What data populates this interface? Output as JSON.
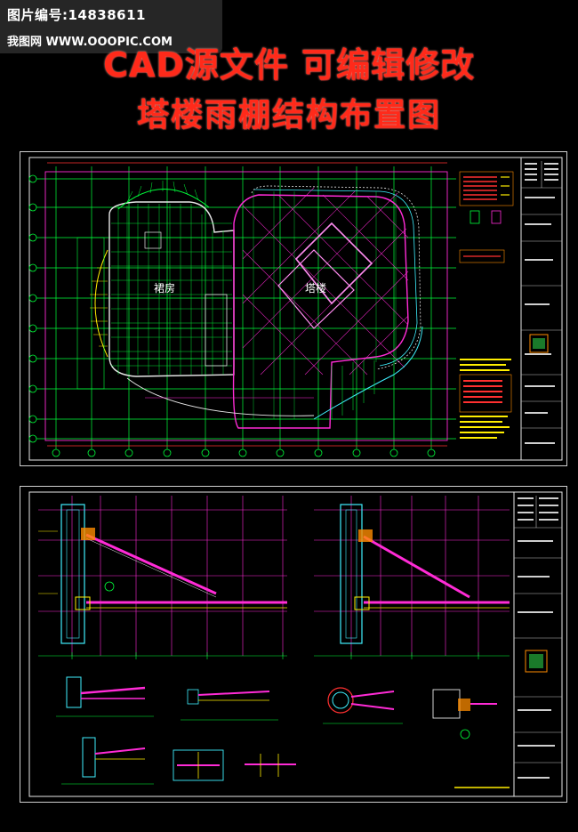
{
  "banner": {
    "image_number_label": "图片编号:14838611",
    "site_label": "我图网  WWW.OOOPIC.COM",
    "headline_line1": "CAD源文件 可编辑修改",
    "headline_line2": "塔楼雨棚结构布置图"
  },
  "sheet1": {
    "label_podium": "裙房",
    "label_tower": "塔楼"
  },
  "colors": {
    "accent_red": "#ff2a1a",
    "cad_green": "#00ff3a",
    "cad_magenta": "#ff2bd6",
    "cad_yellow": "#ffee00",
    "cad_cyan": "#3ff0ff",
    "cad_white": "#e8e8e8",
    "cad_red": "#ff3030",
    "background": "#000000"
  }
}
